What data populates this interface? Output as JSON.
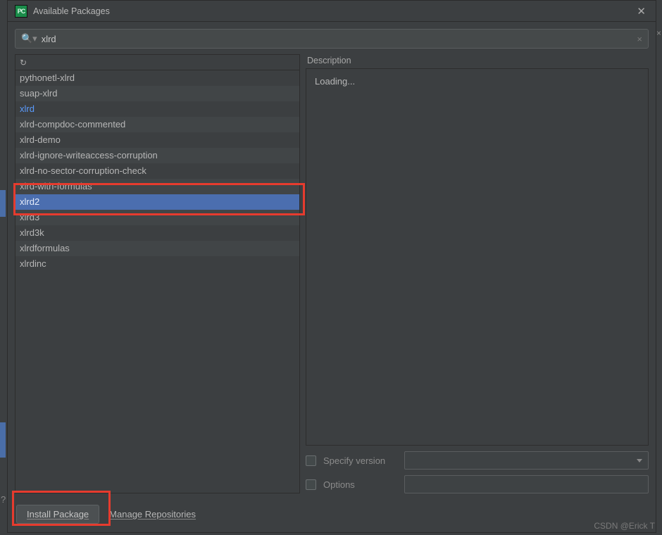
{
  "dialog": {
    "title": "Available Packages",
    "app_icon_text": "PC"
  },
  "search": {
    "value": "xlrd",
    "icon": "search-icon"
  },
  "packages": [
    {
      "name": "pythonetl-xlrd",
      "selected": false,
      "highlighted": false
    },
    {
      "name": "suap-xlrd",
      "selected": false,
      "highlighted": false
    },
    {
      "name": "xlrd",
      "selected": true,
      "highlighted": false
    },
    {
      "name": "xlrd-compdoc-commented",
      "selected": false,
      "highlighted": false
    },
    {
      "name": "xlrd-demo",
      "selected": false,
      "highlighted": false
    },
    {
      "name": "xlrd-ignore-writeaccess-corruption",
      "selected": false,
      "highlighted": false
    },
    {
      "name": "xlrd-no-sector-corruption-check",
      "selected": false,
      "highlighted": false
    },
    {
      "name": "xlrd-with-formulas",
      "selected": false,
      "highlighted": false
    },
    {
      "name": "xlrd2",
      "selected": false,
      "highlighted": true
    },
    {
      "name": "xlrd3",
      "selected": false,
      "highlighted": false
    },
    {
      "name": "xlrd3k",
      "selected": false,
      "highlighted": false
    },
    {
      "name": "xlrdformulas",
      "selected": false,
      "highlighted": false
    },
    {
      "name": "xlrdinc",
      "selected": false,
      "highlighted": false
    }
  ],
  "description": {
    "label": "Description",
    "body": "Loading..."
  },
  "options": {
    "specify_version_label": "Specify version",
    "specify_version_checked": false,
    "specify_version_value": "",
    "options_label": "Options",
    "options_checked": false,
    "options_value": ""
  },
  "footer": {
    "install_label": "Install Package",
    "manage_label": "Manage Repositories"
  },
  "watermark": "CSDN @Erick T"
}
